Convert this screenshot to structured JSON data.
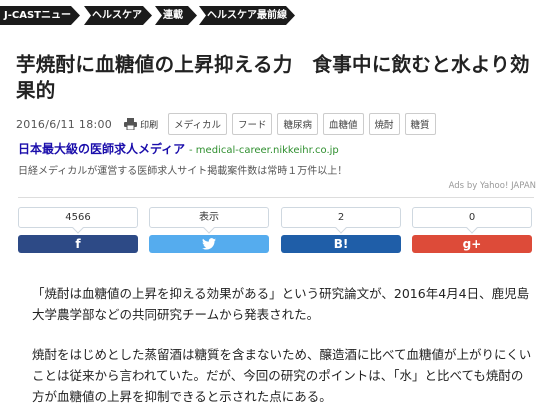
{
  "breadcrumb": [
    "J-CASTニュース",
    "ヘルスケア",
    "連載",
    "ヘルスケア最前線"
  ],
  "article": {
    "title": "芋焼酎に血糖値の上昇抑える力　食事中に飲むと水より効果的",
    "date": "2016/6/11 18:00",
    "print_label": "印刷",
    "tags": [
      "メディカル",
      "フード",
      "糖尿病",
      "血糖値",
      "焼酎",
      "糖質"
    ],
    "paragraphs": [
      "「焼酎は血糖値の上昇を抑える効果がある」という研究論文が、2016年4月4日、鹿児島大学農学部などの共同研究チームから発表された。",
      "焼酎をはじめとした蒸留酒は糖質を含まないため、醸造酒に比べて血糖値が上がりにくいことは従来から言われていた。だが、今回の研究のポイントは、「水」と比べても焼酎の方が血糖値の上昇を抑制できると示された点にある。"
    ]
  },
  "ad": {
    "title": "日本最大級の医師求人メディア",
    "url": "medical-career.nikkeihr.co.jp",
    "description": "日経メディカルが運営する医師求人サイト掲載案件数は常時１万件以上！",
    "ads_by": "Ads by Yahoo! JAPAN"
  },
  "share": {
    "facebook": {
      "count": "4566",
      "icon": "f"
    },
    "twitter": {
      "count": "表示",
      "icon": "twitter-bird-icon"
    },
    "hatena": {
      "count": "2",
      "icon": "B!"
    },
    "googleplus": {
      "count": "0",
      "icon": "g+"
    }
  },
  "colors": {
    "facebook": "#2d4a86",
    "twitter": "#55acee",
    "hatena": "#1f5ea8",
    "googleplus": "#dd4b39",
    "breadcrumb": "#1b1b1b"
  }
}
